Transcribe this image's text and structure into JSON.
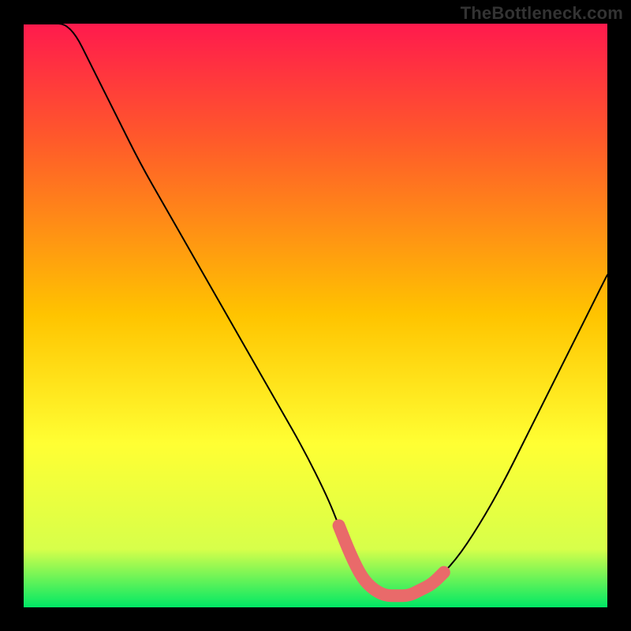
{
  "watermark": "TheBottleneck.com",
  "colors": {
    "frame": "#000000",
    "grad_top": "#ff1a4d",
    "grad_mid1": "#ff5a2a",
    "grad_mid2": "#ffc400",
    "grad_mid3": "#ffff33",
    "grad_mid4": "#d7ff4a",
    "grad_bottom": "#00e865",
    "curve": "#000000",
    "highlight": "#e96a6a"
  },
  "chart_data": {
    "type": "line",
    "title": "",
    "xlabel": "",
    "ylabel": "",
    "xlim": [
      0,
      100
    ],
    "ylim": [
      0,
      100
    ],
    "x": [
      0,
      4,
      8,
      12,
      16,
      20,
      24,
      28,
      32,
      36,
      40,
      44,
      48,
      52,
      54,
      56,
      58,
      60,
      62,
      64,
      66,
      68,
      70,
      74,
      78,
      82,
      86,
      90,
      94,
      98,
      100
    ],
    "values": [
      130,
      112,
      101,
      92,
      84,
      76,
      69,
      62,
      55,
      48,
      41,
      34,
      27,
      19,
      14,
      9,
      5,
      3,
      2,
      2,
      2,
      3,
      4,
      8,
      14,
      21,
      29,
      37,
      45,
      53,
      57
    ],
    "highlight_x_range": [
      54,
      72
    ],
    "annotations": []
  }
}
